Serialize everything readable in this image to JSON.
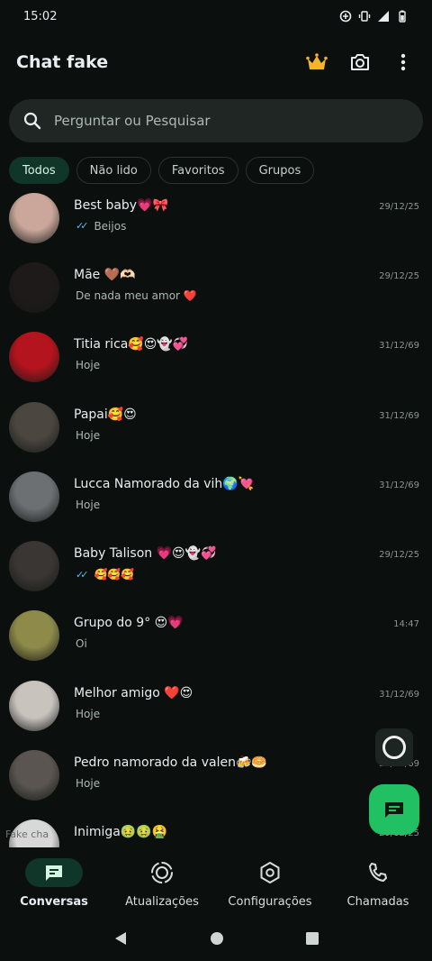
{
  "status": {
    "time": "15:02"
  },
  "app": {
    "title": "Chat fake"
  },
  "search": {
    "placeholder": "Perguntar ou Pesquisar"
  },
  "filters": [
    "Todos",
    "Não lido",
    "Favoritos",
    "Grupos"
  ],
  "chats": [
    {
      "name": "Best baby💗🎀",
      "preview": "Beijos",
      "time": "29/12/25",
      "read_ticks": true,
      "avatar_color": "#caa79a"
    },
    {
      "name": "Mãe 🤎🫶🏻",
      "preview": "De nada meu amor ❤️",
      "time": "29/12/25",
      "read_ticks": false,
      "avatar_color": "#1e1a1a"
    },
    {
      "name": "Titia rica🥰😍👻💞",
      "preview": "Hoje",
      "time": "31/12/69",
      "read_ticks": false,
      "avatar_color": "#b3141d"
    },
    {
      "name": "Papai🥰😍",
      "preview": "Hoje",
      "time": "31/12/69",
      "read_ticks": false,
      "avatar_color": "#4b4640"
    },
    {
      "name": "Lucca Namorado da vih🌍💘",
      "preview": "Hoje",
      "time": "31/12/69",
      "read_ticks": false,
      "avatar_color": "#6d7073"
    },
    {
      "name": "Baby Talison 💗😍👻💞",
      "preview": "🥰🥰🥰",
      "time": "29/12/25",
      "read_ticks": true,
      "avatar_color": "#3a3633"
    },
    {
      "name": "Grupo do 9° 😍💗",
      "preview": "Oi",
      "time": "14:47",
      "read_ticks": false,
      "avatar_color": "#8e8a4a"
    },
    {
      "name": "Melhor amigo ❤️😍",
      "preview": "Hoje",
      "time": "31/12/69",
      "read_ticks": false,
      "avatar_color": "#c9c3be"
    },
    {
      "name": "Pedro namorado da valen🍻🥯",
      "preview": "Hoje",
      "time": "31/12/69",
      "read_ticks": false,
      "avatar_color": "#5a5550"
    },
    {
      "name": "Inimiga🤢🤢🤮",
      "preview": "",
      "time": "29/12/25",
      "read_ticks": false,
      "avatar_color": "#d8d8d8"
    }
  ],
  "watermark": "Fake cha",
  "bottom_nav": [
    "Conversas",
    "Atualizações",
    "Configurações",
    "Chamadas"
  ],
  "colors": {
    "accent": "#21c063",
    "background": "#0b0f0d",
    "active_pill": "#103529",
    "read_tick": "#53bdeb"
  },
  "icons": {
    "premium": "crown-icon",
    "camera": "camera-icon",
    "menu": "more-vert-icon"
  }
}
